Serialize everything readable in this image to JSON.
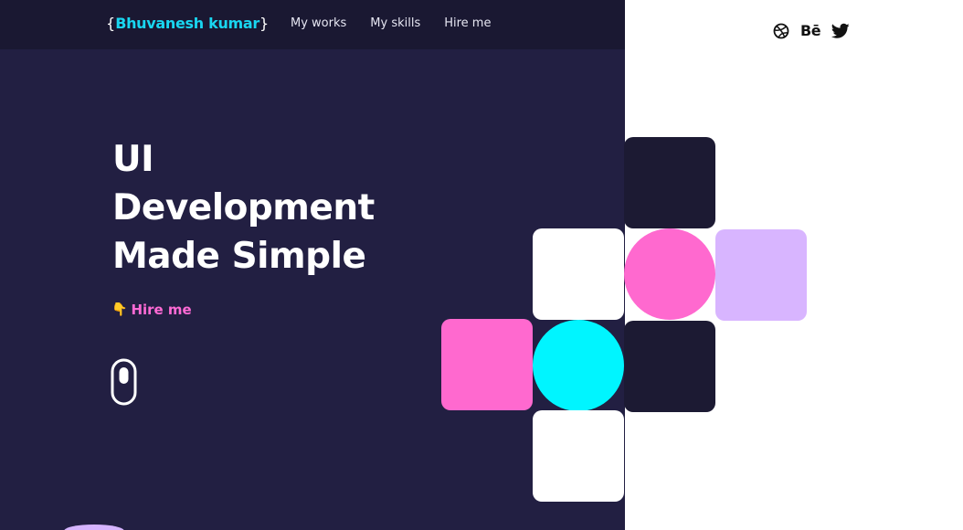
{
  "logo": {
    "open_brace": "{",
    "name": "Bhuvanesh kumar",
    "close_brace": "}"
  },
  "nav": {
    "items": [
      {
        "label": "My works"
      },
      {
        "label": "My skills"
      },
      {
        "label": "Hire me"
      }
    ]
  },
  "social": {
    "icons": [
      "dribbble-icon",
      "behance-icon",
      "twitter-icon"
    ],
    "behance_glyph": "Bē"
  },
  "hero": {
    "title_lines": [
      "UI",
      "Development",
      "Made Simple"
    ],
    "cta_emoji": "👇",
    "cta_label": "Hire me",
    "scroll_icon": "mouse-scroll-icon"
  },
  "colors": {
    "dark_bg": "#221f42",
    "topbar_bg": "#1a1832",
    "accent_cyan": "#19d6f0",
    "accent_pink": "#ff6ad5",
    "tile_dark": "#1c1a33",
    "tile_white": "#ffffff",
    "tile_pink": "#ff69cf",
    "tile_lavender": "#d8b5ff",
    "tile_cyan": "#00f5ff"
  }
}
